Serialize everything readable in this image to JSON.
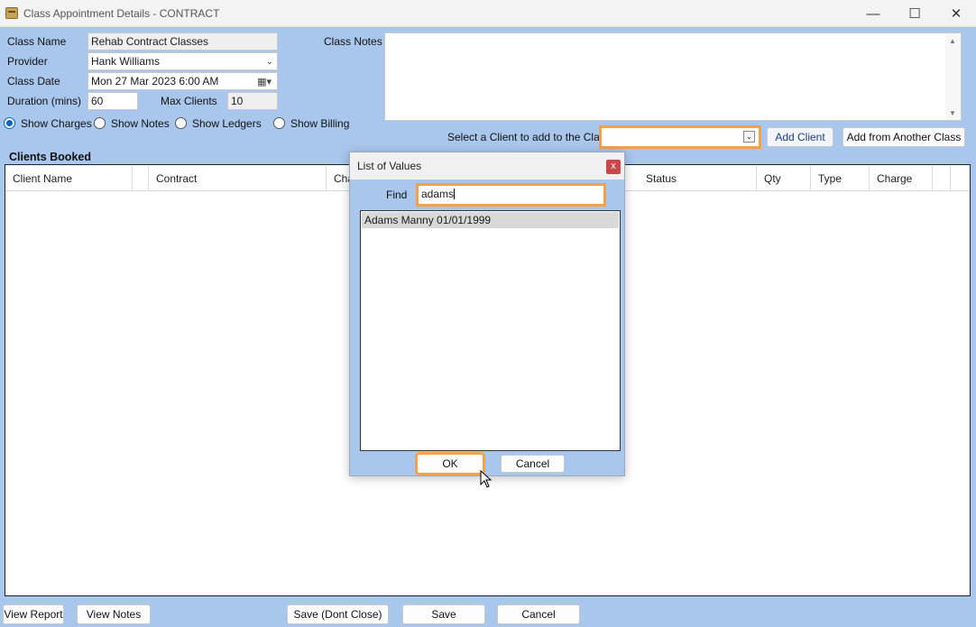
{
  "window": {
    "title": "Class Appointment Details - CONTRACT",
    "minimize_glyph": "—",
    "maximize_glyph": "☐",
    "close_glyph": "✕"
  },
  "form": {
    "class_name_label": "Class Name",
    "class_name_value": "Rehab Contract Classes",
    "provider_label": "Provider",
    "provider_value": "Hank Williams",
    "class_date_label": "Class Date",
    "class_date_value": "Mon 27 Mar 2023   6:00 AM",
    "duration_label": "Duration (mins)",
    "duration_value": "60",
    "max_clients_label": "Max Clients",
    "max_clients_value": "10",
    "class_notes_label": "Class Notes"
  },
  "view_options": [
    {
      "label": "Show Charges",
      "selected": true
    },
    {
      "label": "Show Notes",
      "selected": false
    },
    {
      "label": "Show Ledgers",
      "selected": false
    },
    {
      "label": "Show Billing",
      "selected": false
    }
  ],
  "client_select": {
    "label": "Select a Client to add to the Class",
    "value": "",
    "add_client": "Add Client",
    "add_from_another": "Add from Another Class"
  },
  "clients_booked": {
    "heading": "Clients Booked",
    "columns": [
      "Client Name",
      "Contract",
      "Cha",
      "Status",
      "Qty",
      "Type",
      "Charge"
    ]
  },
  "dialog": {
    "title": "List of Values",
    "close_glyph": "x",
    "find_label": "Find",
    "find_value": "adams",
    "items": [
      "Adams Manny 01/01/1999"
    ],
    "ok": "OK",
    "cancel": "Cancel"
  },
  "footer": {
    "view_report": "View Report",
    "view_notes": "View Notes",
    "save_dont_close": "Save (Dont Close)",
    "save": "Save",
    "cancel": "Cancel"
  },
  "colors": {
    "background": "#a9c6ec",
    "highlight": "#f5a04b",
    "radio_accent": "#0067c0",
    "dialog_close": "#c64848"
  }
}
